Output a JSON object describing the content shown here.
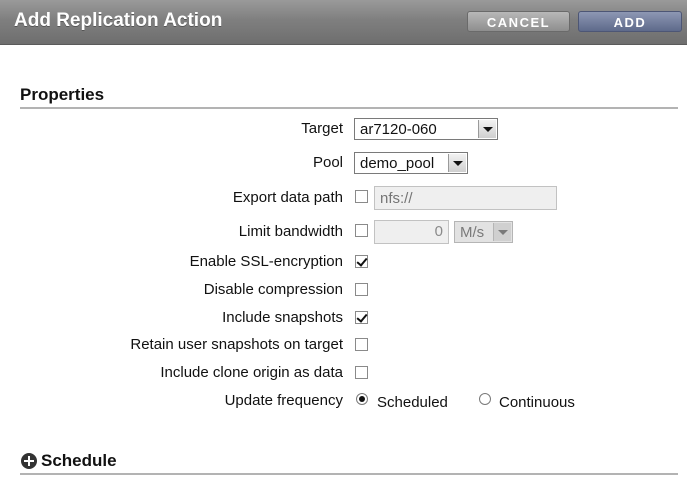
{
  "dialog": {
    "title": "Add Replication Action",
    "cancel_label": "CANCEL",
    "add_label": "ADD"
  },
  "properties": {
    "heading": "Properties",
    "target": {
      "label": "Target",
      "value": "ar7120-060"
    },
    "pool": {
      "label": "Pool",
      "value": "demo_pool"
    },
    "export_data_path": {
      "label": "Export data path",
      "checked": false,
      "placeholder": "nfs://"
    },
    "limit_bandwidth": {
      "label": "Limit bandwidth",
      "checked": false,
      "value": "0",
      "unit": "M/s"
    },
    "enable_ssl": {
      "label": "Enable SSL-encryption",
      "checked": true
    },
    "disable_compression": {
      "label": "Disable compression",
      "checked": false
    },
    "include_snapshots": {
      "label": "Include snapshots",
      "checked": true
    },
    "retain_user_snapshots": {
      "label": "Retain user snapshots on target",
      "checked": false
    },
    "include_clone_origin": {
      "label": "Include clone origin as data",
      "checked": false
    },
    "update_frequency": {
      "label": "Update frequency",
      "selected": "Scheduled",
      "options": [
        "Scheduled",
        "Continuous"
      ]
    }
  },
  "schedule": {
    "heading": "Schedule"
  }
}
